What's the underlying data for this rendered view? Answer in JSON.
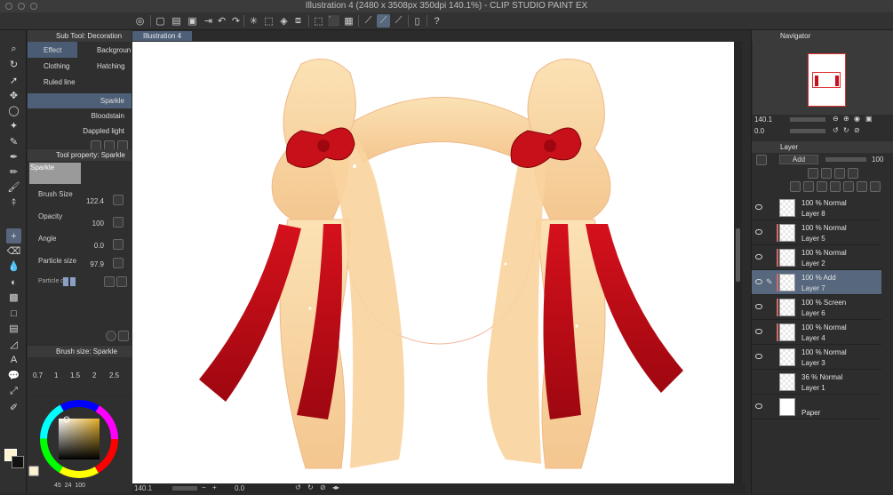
{
  "window": {
    "title": "Illustration 4 (2480 x 3508px 350dpi 140.1%) - CLIP STUDIO PAINT EX"
  },
  "canvas_tab": {
    "label": "Illustration 4"
  },
  "sub_tool_panel": {
    "header": "Sub Tool: Decoration",
    "tabs": [
      "Effect",
      "Backgroun",
      "Clothing",
      "Hatching",
      "Ruled line"
    ],
    "brushes": [
      "Sparkle",
      "Bloodstain",
      "Dappled light"
    ]
  },
  "tool_property": {
    "header": "Tool property: Sparkle",
    "preview_label": "Sparkle",
    "props": [
      {
        "label": "Brush Size",
        "value": "122.4"
      },
      {
        "label": "Opacity",
        "value": "100"
      },
      {
        "label": "Angle",
        "value": "0.0"
      },
      {
        "label": "Particle size",
        "value": "97.9"
      }
    ],
    "particle_label": "Particle d"
  },
  "brush_size_panel": {
    "header": "Brush size: Sparkle",
    "sizes": [
      "0.7",
      "1",
      "1.5",
      "2",
      "2.5"
    ]
  },
  "color_status": {
    "values": [
      "45",
      "24",
      "100"
    ]
  },
  "navigator": {
    "header": "Navigator",
    "zoom": "140.1",
    "angle": "0.0"
  },
  "layer_panel": {
    "header": "Layer",
    "blend_mode": "Add",
    "opacity": "100",
    "layers": [
      {
        "mode": "100 %  Normal",
        "name": "Layer 8"
      },
      {
        "mode": "100 %  Normal",
        "name": "Layer 5"
      },
      {
        "mode": "100 %  Normal",
        "name": "Layer 2"
      },
      {
        "mode": "100 %  Add",
        "name": "Layer 7"
      },
      {
        "mode": "100 %  Screen",
        "name": "Layer 6"
      },
      {
        "mode": "100 %  Normal",
        "name": "Layer 4"
      },
      {
        "mode": "100 %  Normal",
        "name": "Layer 3"
      },
      {
        "mode": "36 %  Normal",
        "name": "Layer 1"
      },
      {
        "mode": "",
        "name": "Paper"
      }
    ]
  },
  "statusbar": {
    "zoom": "140.1",
    "angle": "0.0"
  },
  "colors": {
    "accent": "#56677e",
    "ribbon": "#c0141c",
    "hair": "#f8d5a3"
  }
}
